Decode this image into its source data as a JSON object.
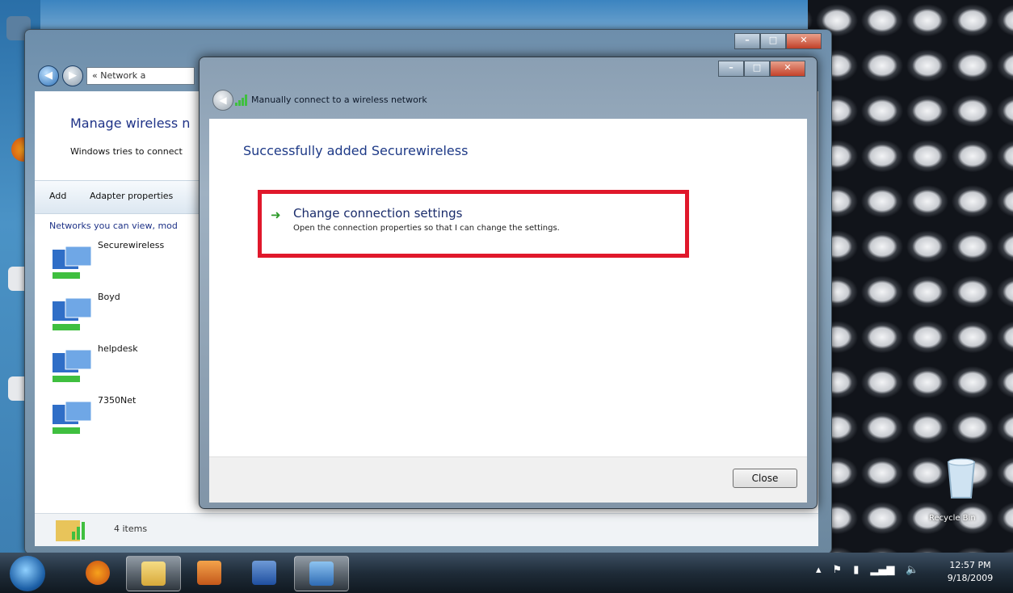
{
  "desktop": {
    "recycle_bin_label": "Recycle Bin"
  },
  "explorer": {
    "address": "« Network a",
    "title": "Manage wireless n",
    "subtitle": "Windows tries to connect",
    "toolbar": [
      "Add",
      "Adapter properties"
    ],
    "list_header": "Networks you can view, mod",
    "networks": [
      "Securewireless",
      "Boyd",
      "helpdesk",
      "7350Net"
    ],
    "status": "4 items"
  },
  "dialog": {
    "title": "Manually connect to a wireless network",
    "heading": "Successfully added Securewireless",
    "link_title": "Change connection settings",
    "link_desc": "Open the connection properties so that I can change the settings.",
    "close_label": "Close",
    "highlight_color": "#e0182b"
  },
  "taskbar": {
    "time": "12:57 PM",
    "date": "9/18/2009"
  }
}
